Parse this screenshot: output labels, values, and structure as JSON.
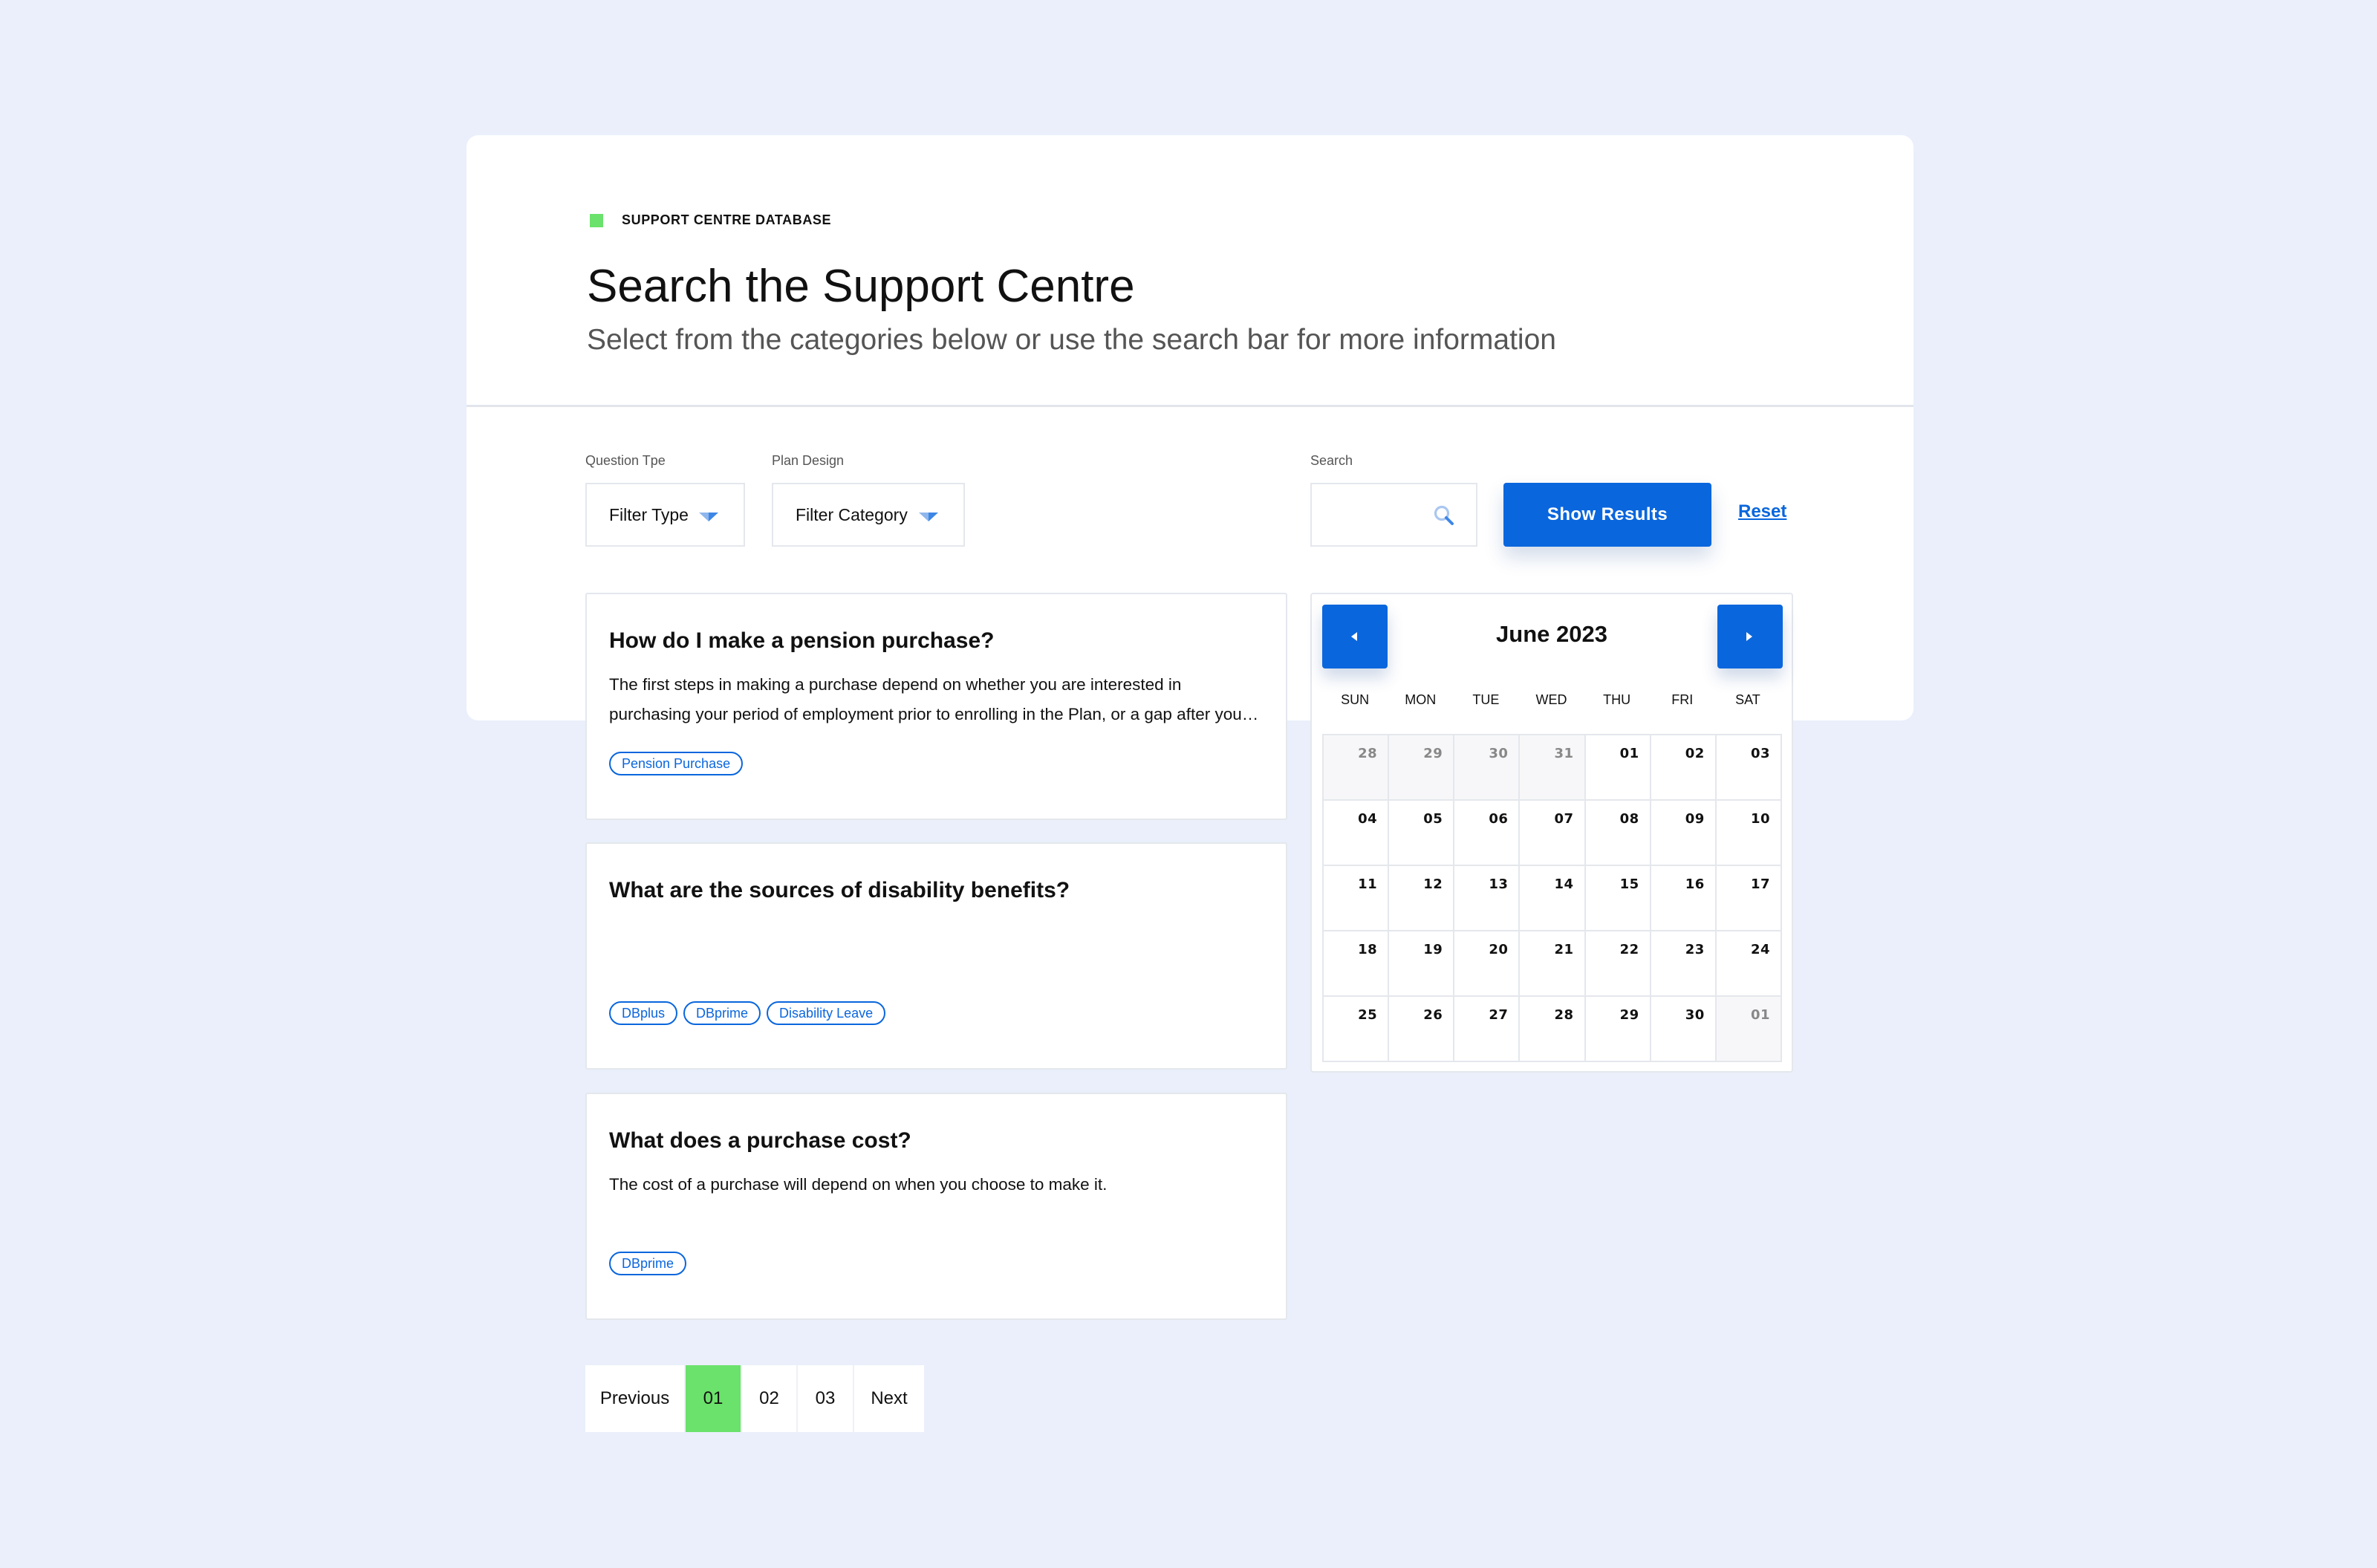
{
  "header": {
    "eyebrow": "SUPPORT CENTRE DATABASE",
    "title": "Search the Support Centre",
    "subtitle": "Select from the categories below or use the search bar for more information"
  },
  "filters": {
    "question_type": {
      "label": "Question Tpe",
      "value": "Filter Type"
    },
    "plan_design": {
      "label": "Plan Design",
      "value": "Filter Category"
    },
    "search": {
      "label": "Search",
      "value": "",
      "icon": "search-icon"
    },
    "show_results": "Show Results",
    "reset": "Reset"
  },
  "results": [
    {
      "question": "How do I make a pension purchase?",
      "answer": "The first steps in making a purchase depend on whether you are interested in purchasing your period of employment prior to enrolling in the Plan, or a gap after your enrolment.",
      "tags": [
        "Pension Purchase"
      ]
    },
    {
      "question": "What are the sources of disability benefits?",
      "answer": "",
      "tags": [
        "DBplus",
        "DBprime",
        "Disability Leave"
      ]
    },
    {
      "question": "What does a purchase cost?",
      "answer": "The cost of a purchase will depend on when you choose to make it.",
      "tags": [
        "DBprime"
      ]
    }
  ],
  "pagination": {
    "previous": "Previous",
    "pages": [
      "01",
      "02",
      "03"
    ],
    "current": "01",
    "next": "Next"
  },
  "calendar": {
    "month": "June 2023",
    "weekdays": [
      "SUN",
      "MON",
      "TUE",
      "WED",
      "THU",
      "FRI",
      "SAT"
    ],
    "days": [
      {
        "d": "28",
        "muted": true
      },
      {
        "d": "29",
        "muted": true
      },
      {
        "d": "30",
        "muted": true
      },
      {
        "d": "31",
        "muted": true
      },
      {
        "d": "01"
      },
      {
        "d": "02"
      },
      {
        "d": "03"
      },
      {
        "d": "04"
      },
      {
        "d": "05"
      },
      {
        "d": "06"
      },
      {
        "d": "07"
      },
      {
        "d": "08"
      },
      {
        "d": "09"
      },
      {
        "d": "10"
      },
      {
        "d": "11"
      },
      {
        "d": "12"
      },
      {
        "d": "13"
      },
      {
        "d": "14"
      },
      {
        "d": "15"
      },
      {
        "d": "16"
      },
      {
        "d": "17"
      },
      {
        "d": "18"
      },
      {
        "d": "19"
      },
      {
        "d": "20"
      },
      {
        "d": "21"
      },
      {
        "d": "22"
      },
      {
        "d": "23"
      },
      {
        "d": "24"
      },
      {
        "d": "25"
      },
      {
        "d": "26"
      },
      {
        "d": "27"
      },
      {
        "d": "28"
      },
      {
        "d": "29"
      },
      {
        "d": "30"
      },
      {
        "d": "01",
        "muted": true
      }
    ],
    "prev_icon": "caret-left-icon",
    "next_icon": "caret-right-icon"
  },
  "colors": {
    "background": "#eaeffb",
    "primary": "#0a66dd",
    "accent_green": "#6be26b"
  }
}
